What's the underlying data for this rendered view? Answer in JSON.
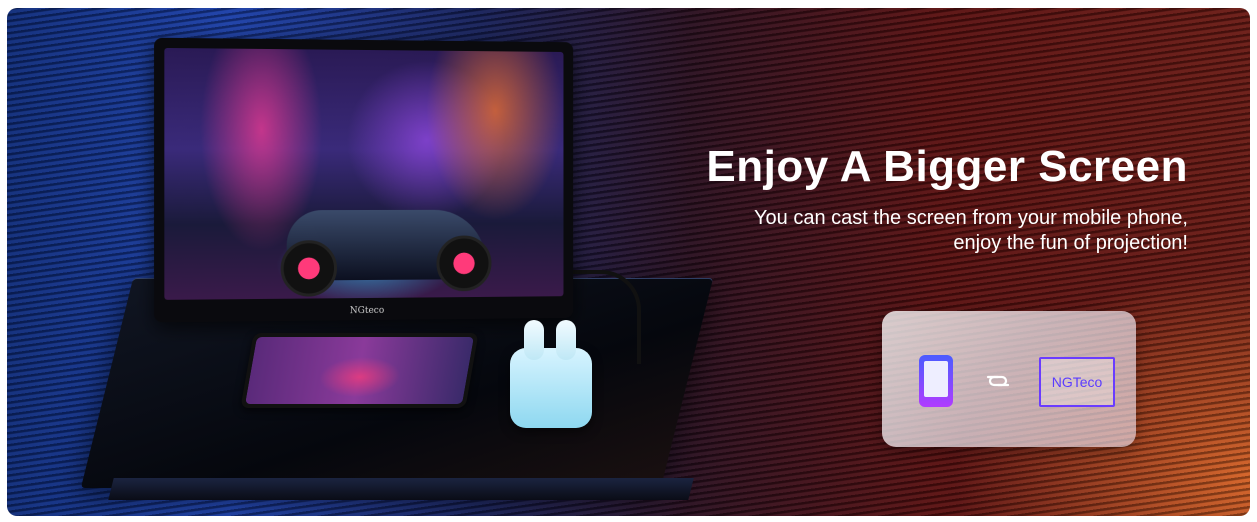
{
  "headline": {
    "title": "Enjoy A Bigger Screen",
    "subtitle": "You can cast the screen from your mobile phone, enjoy the fun of projection!"
  },
  "monitor": {
    "bezel_logo": "NGteco"
  },
  "cast_card": {
    "source_icon": "smartphone-icon",
    "link_icon": "link-icon",
    "target_label": "NGTeco"
  },
  "colors": {
    "left_tint": "#1a3ea8",
    "right_tint": "#6a1a14",
    "accent_purple": "#6a3cff"
  }
}
